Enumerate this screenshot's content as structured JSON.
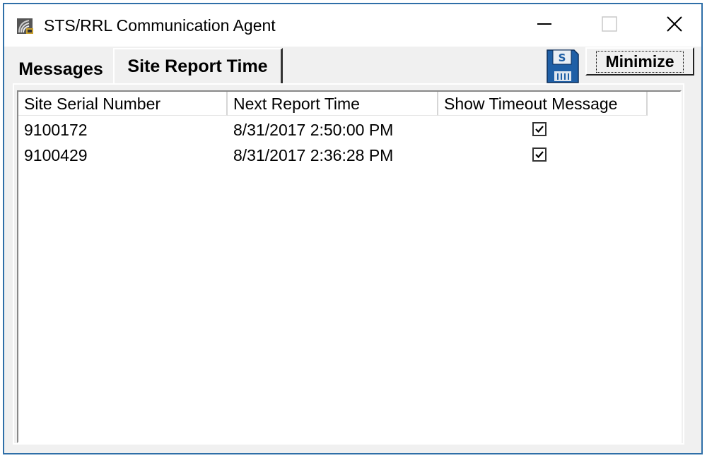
{
  "window": {
    "title": "STS/RRL Communication Agent",
    "app_icon": "satellite-signal-icon",
    "controls": [
      "minimize-window-icon",
      "maximize-window-icon",
      "close-icon"
    ]
  },
  "tabs": [
    {
      "label": "Messages",
      "selected": false
    },
    {
      "label": "Site Report Time",
      "selected": true
    }
  ],
  "toolbar": {
    "save_icon": "floppy-disk-save-icon",
    "save_letter": "S",
    "minimize_label": "Minimize"
  },
  "table": {
    "columns": [
      "Site Serial Number",
      "Next Report Time",
      "Show Timeout Message"
    ],
    "rows": [
      {
        "serial": "9100172",
        "next_report_time": "8/31/2017 2:50:00 PM",
        "show_timeout": true
      },
      {
        "serial": "9100429",
        "next_report_time": "8/31/2017 2:36:28 PM",
        "show_timeout": true
      }
    ]
  },
  "colors": {
    "window_border": "#2f6fa8",
    "floppy_blue": "#1f5fa6"
  }
}
